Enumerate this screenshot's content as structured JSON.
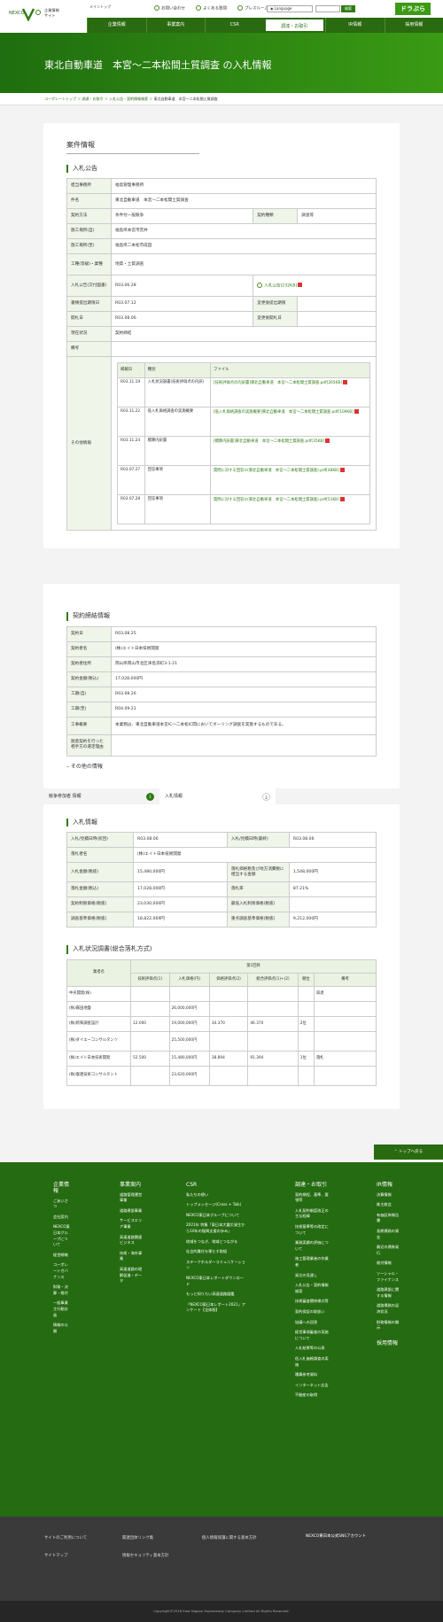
{
  "header": {
    "company_line1": "企業情報",
    "company_line2": "サイト",
    "main_top": "メイントップ",
    "links": [
      "お問い合わせ",
      "よくある質問",
      "プレスルーム"
    ],
    "language": "Language",
    "search_btn": "検索",
    "dorapura": "ドラぷら"
  },
  "gnav": [
    "企業情報",
    "事業案内",
    "CSR",
    "調達・お取引",
    "IR情報",
    "採用情報"
  ],
  "hero_title": "東北自動車道　本宮～二本松間土質調査 の入札情報",
  "breadcrumb": [
    "コーポレートトップ",
    "調達・お取引",
    "入札公告・契約情報検索",
    "東北自動車道　本宮～二本松間土質調査"
  ],
  "case_heading": "案件情報",
  "notice": {
    "heading": "入札公告",
    "rows": [
      {
        "k": "担当事務所",
        "v": "福島管理事務所"
      },
      {
        "k": "件名",
        "v": "東北自動車道　本宮～二本松間土質調査"
      }
    ],
    "method_k": "契約方法",
    "method_v": "条件付一般競争",
    "type_k": "契約種類",
    "type_v": "調査等",
    "place_from_k": "施工場所(自)",
    "place_from_v": "福島県本宮市荒井",
    "place_to_k": "施工場所(至)",
    "place_to_v": "福島県二本松市成田",
    "work_k": "工種(等級)・業種",
    "work_v": "地質・土質調査",
    "pub_k": "入札公告(交付図書)",
    "pub_v": "R03.06.28",
    "pub_file": "入札公告[232KB]",
    "doc_k": "書類提出期限日",
    "doc_v": "R03.07.12",
    "change_k": "変更後提出期限",
    "change_v": "",
    "open_k": "開札日",
    "open_v": "R03.08.06",
    "change_open_k": "変更後開札日",
    "change_open_v": "",
    "status_k": "現在状況",
    "status_v": "契約締結",
    "note_k": "備考",
    "note_v": "",
    "other_k": "その他情報",
    "other_cols": [
      "掲載日",
      "種別",
      "ファイル"
    ],
    "other_rows": [
      {
        "date": "R03.11.19",
        "kind": "入札状況調書(技術評価点の内訳)",
        "file": "[技術評価点の内訳書]東北自動車道　本宮～二本松間土質調査.pdf[265KB]"
      },
      {
        "date": "R03.11.22",
        "kind": "低入札価格調査の実施概要",
        "file": "[低入札価格調査の実施概要]東北自動車道　本宮～二本松間土質調査.pdf[109KB]"
      },
      {
        "date": "R03.11.24",
        "kind": "積算内訳書",
        "file": "[積算内訳書]東北自動車道　本宮～二本松間土質調査.pdf[35KB]"
      },
      {
        "date": "R03.07.27",
        "kind": "回答事項",
        "file": "質問に対する回答①(東北自動車道　本宮～二本松間土質調査).pdf[48KB]"
      },
      {
        "date": "R03.07.28",
        "kind": "回答事項",
        "file": "質問に対する回答②(東北自動車道　本宮～二本松間土質調査).pdf[51KB]"
      }
    ]
  },
  "contract": {
    "heading": "契約締結情報",
    "rows": [
      {
        "k": "契約日",
        "v": "R03.08.25"
      },
      {
        "k": "契約者名",
        "v": "(株)エイト日本技術開発"
      },
      {
        "k": "契約者住所",
        "v": "岡山県岡山市北区津島京町3-1-21"
      },
      {
        "k": "契約金額(税込)",
        "v": "17,028,000円"
      },
      {
        "k": "工期(自)",
        "v": "R03.08.26"
      },
      {
        "k": "工期(至)",
        "v": "R04.09.21"
      },
      {
        "k": "工事概要",
        "v": "本業務は、東北自動車道本宮IC～二本松IC間においてボーリング調査を実施するものである。"
      },
      {
        "k": "随意契約を行った相手方の選定理由",
        "v": ""
      }
    ]
  },
  "other_info": "その他の情報",
  "tabs": [
    {
      "label": "競争参加者 情報",
      "num": "1"
    },
    {
      "label": "入札情報",
      "num": "2"
    }
  ],
  "bid": {
    "heading": "入札情報",
    "rows": [
      [
        "入札/見積日時(初回)",
        "R03.08.06",
        "入札/見積日時(最終)",
        "R03.08.06"
      ],
      [
        "落札者名",
        "(株)エイト日本技術開発",
        "",
        ""
      ],
      [
        "入札金額(税抜)",
        "15,480,000円",
        "落札価格税及び地方消費税に相当する金額",
        "1,548,000円"
      ],
      [
        "落札金額(税込)",
        "17,028,000円",
        "落札率",
        "87.21%"
      ],
      [
        "契約制限価格(税抜)",
        "23,030,000円",
        "最低入札制限価格(税抜)",
        ""
      ],
      [
        "調査基準価格(税抜)",
        "18,822,069円",
        "重点調査基準価格(税抜)",
        "9,212,000円"
      ]
    ]
  },
  "status": {
    "heading": "入札状況調書(総合落札方式)",
    "round": "第1回目",
    "cols": [
      "業者名",
      "技術評価点(1)",
      "入札価格(円)",
      "価格評価点(2)",
      "総合評価点(1)+(2)",
      "順位",
      "備考"
    ],
    "rows": [
      [
        "中央開発(株)",
        "",
        "",
        "",
        "",
        "",
        "辞退"
      ],
      [
        "(株)霧田地盤",
        "",
        "26,000,000円",
        "",
        "",
        "",
        ""
      ],
      [
        "(株)新和調査設計",
        "12.000",
        "19,000,000円",
        "34.370",
        "46.370",
        "2位",
        ""
      ],
      [
        "(株)ダイエーコンサルタンツ",
        "",
        "25,500,000円",
        "",
        "",
        "",
        ""
      ],
      [
        "(株)エイト日本技術開発",
        "52.500",
        "15,480,000円",
        "38.894",
        "91.394",
        "1位",
        "落札"
      ],
      [
        "(株)復建技術コンサルタント",
        "",
        "23,620,000円",
        "",
        "",
        "",
        ""
      ]
    ]
  },
  "totop": "トップへ戻る",
  "footer": {
    "cols": [
      {
        "h": "企業情報",
        "items": [
          "ごあいさつ",
          "会社案内",
          "NEXCO東日本グループについて",
          "経営戦略",
          "コーポレートガバナンス",
          "財務・決算・格付",
          "一般事業主行動計画",
          "情報の公開"
        ]
      },
      {
        "h": "事業案内",
        "items": [
          "道路管理運営事業",
          "道路建設事業",
          "サービスエリア事業",
          "高速道路関連ビジネス",
          "技術・海外事業",
          "高速道路の理解促進・データ"
        ]
      },
      {
        "h": "CSR",
        "items": [
          "私たちの想い",
          "トップメッセージ(Cross + Talk)",
          "NEXCO東日本グループについて",
          "2021年 特集「東日本大震災発生から10年の復興支援の歩み」",
          "地域をつなぎ、地域とつながる",
          "社会的責任を果たす取組",
          "ステークホルダーコミュニケーション",
          "NEXCO東日本レポートダウンロード",
          "もっと知りたい高速道路図鑑",
          "「NEXCO東日本レポート2021」アンケート【全体版】"
        ]
      },
      {
        "h": "調達・お取引",
        "items": [
          "契約規程、基準、要領等",
          "入札契約制度改正の主な経緯",
          "技術基準等の改定について",
          "業務実績の評価について",
          "施工管理業者の作業者",
          "発注の見通し",
          "入札公告・契約情報検索",
          "技術審査関係様式等",
          "契約保証の取扱い",
          "協議への回答",
          "経営事項審査の実施について",
          "入札結果等の公表",
          "低入札価格調査の実施",
          "積算参考資料",
          "インターネット広告",
          "不動産の取得"
        ]
      },
      {
        "h": "IR情報",
        "items": [
          "決算情報",
          "株主総会",
          "有価証券報告書",
          "長期債務の資金",
          "最近の債券発行",
          "格付情報",
          "ソーシャル・ファイナンス",
          "道路建設に関する情報",
          "道路債務の返済状況",
          "財務情報の開示"
        ]
      }
    ],
    "recruit": "採用情報",
    "sublinks": [
      [
        "サイトのご利用について",
        "関連団体リンク集",
        "個人情報保護に関する基本方針"
      ],
      [
        "サイトマップ",
        "情報セキュリティ基本方針",
        ""
      ]
    ],
    "sns": "NEXCO東日本公式SNSアカウント",
    "copyright": "Copyright©2018 East Nippon Expressway Company Limited All Rights Reserved."
  }
}
